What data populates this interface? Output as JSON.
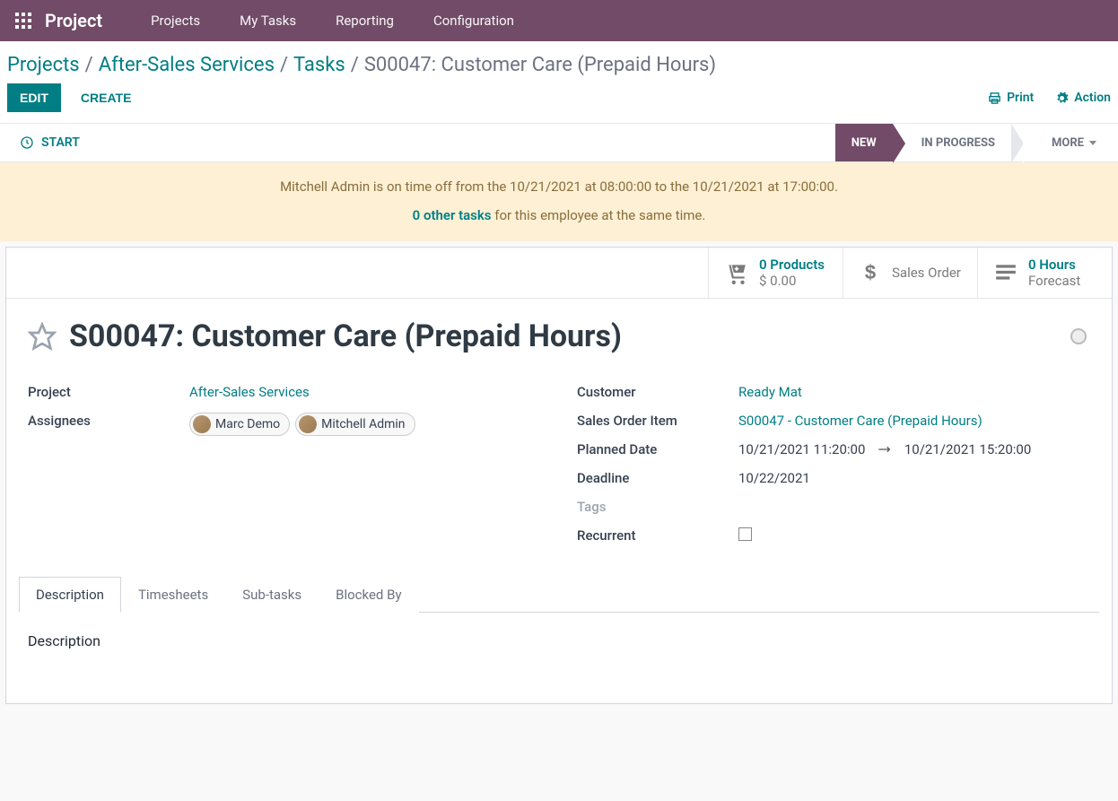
{
  "nav": {
    "brand": "Project",
    "items": [
      "Projects",
      "My Tasks",
      "Reporting",
      "Configuration"
    ]
  },
  "breadcrumb": {
    "items": [
      "Projects",
      "After-Sales Services",
      "Tasks"
    ],
    "current": "S00047: Customer Care (Prepaid Hours)"
  },
  "buttons": {
    "edit": "EDIT",
    "create": "CREATE",
    "print": "Print",
    "action": "Action",
    "start": "START"
  },
  "stages": {
    "new": "NEW",
    "in_progress": "IN PROGRESS",
    "more": "MORE"
  },
  "alert": {
    "line1": "Mitchell Admin is on time off from the 10/21/2021 at 08:00:00 to the 10/21/2021 at 17:00:00.",
    "link": "0 other tasks",
    "line2_suffix": " for this employee at the same time."
  },
  "stats": {
    "products": {
      "top": "0 Products",
      "bottom": "$ 0.00"
    },
    "sales_order": {
      "bottom": "Sales Order"
    },
    "hours": {
      "top": "0  Hours",
      "bottom": "Forecast"
    }
  },
  "title": "S00047: Customer Care (Prepaid Hours)",
  "fields": {
    "left": {
      "project_label": "Project",
      "project_value": "After-Sales Services",
      "assignees_label": "Assignees",
      "assignee1": "Marc Demo",
      "assignee2": "Mitchell Admin"
    },
    "right": {
      "customer_label": "Customer",
      "customer_value": "Ready Mat",
      "so_item_label": "Sales Order Item",
      "so_item_value": "S00047 - Customer Care (Prepaid Hours)",
      "planned_label": "Planned Date",
      "planned_from": "10/21/2021 11:20:00",
      "planned_to": "10/21/2021 15:20:00",
      "deadline_label": "Deadline",
      "deadline_value": "10/22/2021",
      "tags_label": "Tags",
      "recurrent_label": "Recurrent"
    }
  },
  "tabs": {
    "description": "Description",
    "timesheets": "Timesheets",
    "subtasks": "Sub-tasks",
    "blocked": "Blocked By"
  },
  "tab_content": {
    "description": "Description"
  }
}
